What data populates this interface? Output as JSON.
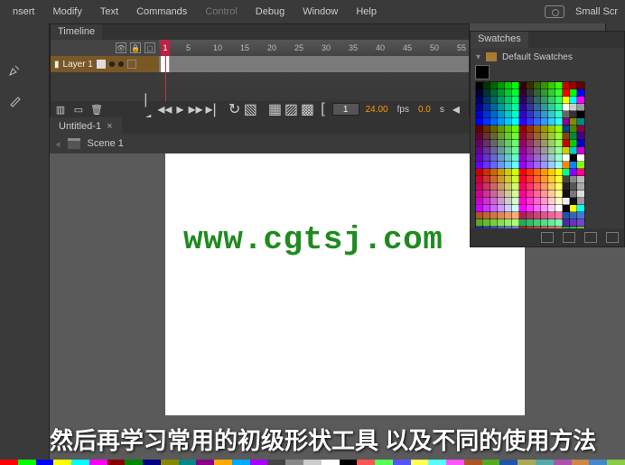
{
  "menubar": {
    "items": [
      "nsert",
      "Modify",
      "Text",
      "Commands",
      "Control",
      "Debug",
      "Window",
      "Help"
    ],
    "dim_index": 4,
    "workspace_label": "Small Scr"
  },
  "timeline": {
    "tab": "Timeline",
    "layer_name": "Layer 1",
    "ticks": [
      "1",
      "5",
      "10",
      "15",
      "20",
      "25",
      "30",
      "35",
      "40",
      "45",
      "50",
      "55"
    ],
    "playhead": "1",
    "frame_input": "1",
    "fps": "24.00",
    "fps_unit": "fps",
    "elapsed": "0.0",
    "elapsed_unit": "s"
  },
  "document": {
    "tab_name": "Untitled-1",
    "scene_name": "Scene 1"
  },
  "watermark": "www.cgtsj.com",
  "subtitle": "然后再学习常用的初级形状工具 以及不同的使用方法",
  "swatches": {
    "tab": "Swatches",
    "group": "Default Swatches",
    "colors": [
      "#000",
      "#030",
      "#060",
      "#090",
      "#0c0",
      "#0f0",
      "#300",
      "#330",
      "#360",
      "#390",
      "#3c0",
      "#3f0",
      "#c00",
      "#900",
      "#600",
      "#003",
      "#033",
      "#063",
      "#093",
      "#0c3",
      "#0f3",
      "#303",
      "#333",
      "#363",
      "#393",
      "#3c3",
      "#3f3",
      "#f00",
      "#0f0",
      "#00f",
      "#006",
      "#036",
      "#066",
      "#096",
      "#0c6",
      "#0f6",
      "#306",
      "#336",
      "#366",
      "#396",
      "#3c6",
      "#3f6",
      "#ff0",
      "#0ff",
      "#f0f",
      "#009",
      "#039",
      "#069",
      "#099",
      "#0c9",
      "#0f9",
      "#309",
      "#339",
      "#369",
      "#399",
      "#3c9",
      "#3f9",
      "#fff",
      "#ccc",
      "#999",
      "#00c",
      "#03c",
      "#06c",
      "#09c",
      "#0cc",
      "#0fc",
      "#30c",
      "#33c",
      "#36c",
      "#39c",
      "#3cc",
      "#3fc",
      "#666",
      "#333",
      "#000",
      "#00f",
      "#03f",
      "#06f",
      "#09f",
      "#0cf",
      "#0ff",
      "#30f",
      "#33f",
      "#36f",
      "#39f",
      "#3cf",
      "#3ff",
      "#808",
      "#880",
      "#088",
      "#600",
      "#630",
      "#660",
      "#690",
      "#6c0",
      "#6f0",
      "#900",
      "#930",
      "#960",
      "#990",
      "#9c0",
      "#9f0",
      "#048",
      "#480",
      "#804",
      "#603",
      "#633",
      "#663",
      "#693",
      "#6c3",
      "#6f3",
      "#903",
      "#933",
      "#963",
      "#993",
      "#9c3",
      "#9f3",
      "#840",
      "#084",
      "#408",
      "#606",
      "#636",
      "#666",
      "#696",
      "#6c6",
      "#6f6",
      "#906",
      "#936",
      "#966",
      "#996",
      "#9c6",
      "#9f6",
      "#c00",
      "#0c0",
      "#00c",
      "#609",
      "#639",
      "#669",
      "#699",
      "#6c9",
      "#6f9",
      "#909",
      "#939",
      "#969",
      "#999",
      "#9c9",
      "#9f9",
      "#cc0",
      "#0cc",
      "#c0c",
      "#60c",
      "#63c",
      "#66c",
      "#69c",
      "#6cc",
      "#6fc",
      "#90c",
      "#93c",
      "#96c",
      "#99c",
      "#9cc",
      "#9fc",
      "#fff",
      "#000",
      "#fff",
      "#60f",
      "#63f",
      "#66f",
      "#69f",
      "#6cf",
      "#6ff",
      "#90f",
      "#93f",
      "#96f",
      "#99f",
      "#9cf",
      "#9ff",
      "#f80",
      "#08f",
      "#8f0",
      "#c00",
      "#c30",
      "#c60",
      "#c90",
      "#cc0",
      "#cf0",
      "#f00",
      "#f30",
      "#f60",
      "#f90",
      "#fc0",
      "#ff0",
      "#0f8",
      "#80f",
      "#f08",
      "#c03",
      "#c33",
      "#c63",
      "#c93",
      "#cc3",
      "#cf3",
      "#f03",
      "#f33",
      "#f63",
      "#f93",
      "#fc3",
      "#ff3",
      "#444",
      "#888",
      "#bbb",
      "#c06",
      "#c36",
      "#c66",
      "#c96",
      "#cc6",
      "#cf6",
      "#f06",
      "#f36",
      "#f66",
      "#f96",
      "#fc6",
      "#ff6",
      "#222",
      "#555",
      "#aaa",
      "#c09",
      "#c39",
      "#c69",
      "#c99",
      "#cc9",
      "#cf9",
      "#f09",
      "#f39",
      "#f69",
      "#f99",
      "#fc9",
      "#ff9",
      "#111",
      "#777",
      "#ddd",
      "#c0c",
      "#c3c",
      "#c6c",
      "#c9c",
      "#ccc",
      "#cfc",
      "#f0c",
      "#f3c",
      "#f6c",
      "#f9c",
      "#fcc",
      "#ffc",
      "#eee",
      "#111",
      "#999",
      "#c0f",
      "#c3f",
      "#c6f",
      "#c9f",
      "#ccf",
      "#cff",
      "#f0f",
      "#f3f",
      "#f6f",
      "#f9f",
      "#fcf",
      "#fff",
      "#101",
      "#ff0",
      "#0ff",
      "#a52",
      "#b63",
      "#c74",
      "#d85",
      "#e96",
      "#fa7",
      "#a25",
      "#b36",
      "#c47",
      "#d58",
      "#e69",
      "#f7a",
      "#25a",
      "#36b",
      "#47c",
      "#5a2",
      "#6b3",
      "#7c4",
      "#8d5",
      "#9e6",
      "#af7",
      "#2a5",
      "#3b6",
      "#4c7",
      "#5d8",
      "#6e9",
      "#7fa",
      "#52a",
      "#63b",
      "#74c",
      "#22a",
      "#33b",
      "#44c",
      "#55d",
      "#66e",
      "#77f",
      "#a22",
      "#b33",
      "#c44",
      "#d55",
      "#e66",
      "#f77",
      "#2a2",
      "#3b3",
      "#4c4"
    ]
  },
  "bottom_strip": [
    "#f00",
    "#0f0",
    "#00f",
    "#ff0",
    "#0ff",
    "#f0f",
    "#800",
    "#080",
    "#008",
    "#880",
    "#088",
    "#808",
    "#fa0",
    "#0af",
    "#a0f",
    "#444",
    "#888",
    "#ccc",
    "#fff",
    "#000",
    "#f55",
    "#5f5",
    "#55f",
    "#ff5",
    "#5ff",
    "#f5f",
    "#a52",
    "#5a2",
    "#25a",
    "#aa5",
    "#5aa",
    "#a5a",
    "#c84",
    "#48c",
    "#8c4"
  ]
}
